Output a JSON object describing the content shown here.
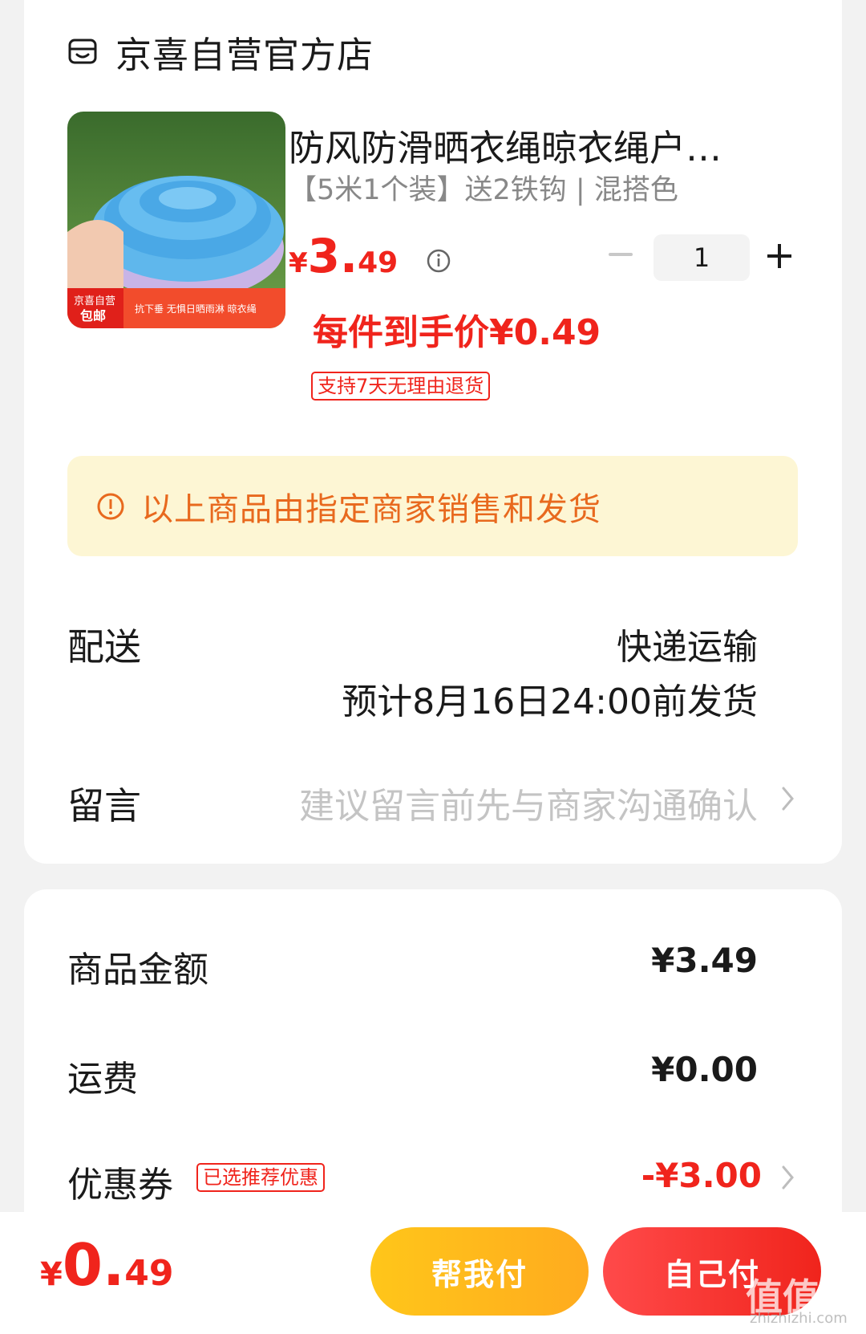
{
  "store": {
    "name": "京喜自营官方店",
    "icon": "store-icon"
  },
  "product": {
    "title": "防风防滑晒衣绳晾衣绳户…",
    "spec": "【5米1个装】送2铁钩 | 混搭色",
    "price_symbol": "¥",
    "price_int": "3.",
    "price_dec": "49",
    "quantity": "1",
    "per_item_price": "每件到手价¥0.49",
    "return_tag": "支持7天无理由退货",
    "image_badge_top": "京喜自营",
    "image_badge_bottom": "包邮",
    "image_caption": "抗下垂 无惧日晒雨淋 晾衣绳"
  },
  "notice": {
    "text": "以上商品由指定商家销售和发货"
  },
  "shipping": {
    "label": "配送",
    "method": "快递运输",
    "eta": "预计8月16日24:00前发货"
  },
  "message": {
    "label": "留言",
    "placeholder": "建议留言前先与商家沟通确认"
  },
  "summary": {
    "goods_label": "商品金额",
    "goods_value": "¥3.49",
    "freight_label": "运费",
    "freight_value": "¥0.00",
    "coupon_label": "优惠券",
    "coupon_tag": "已选推荐优惠",
    "coupon_value": "-¥3.00"
  },
  "footer": {
    "total_symbol": "¥",
    "total_int": "0.",
    "total_dec": "49",
    "help_pay": "帮我付",
    "self_pay": "自己付"
  },
  "watermark": {
    "text": "值值值",
    "sub": "zhizhizhi.com"
  },
  "colors": {
    "accent_red": "#f0241c",
    "notice_bg": "#fdf6d4",
    "notice_text": "#e8691e",
    "help_btn": "#ffb81c"
  }
}
